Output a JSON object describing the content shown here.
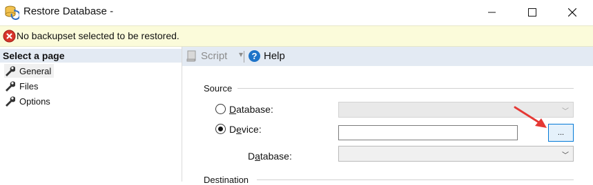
{
  "window": {
    "title": "Restore Database -",
    "controls": {
      "minimize": "—",
      "maximize": "☐",
      "close": "✕"
    }
  },
  "infobar": {
    "message": "No backupset selected to be restored.",
    "icon": "error-icon"
  },
  "sidebar": {
    "header": "Select a page",
    "items": [
      {
        "label": "General",
        "icon": "wrench-icon",
        "selected": true
      },
      {
        "label": "Files",
        "icon": "wrench-icon",
        "selected": false
      },
      {
        "label": "Options",
        "icon": "wrench-icon",
        "selected": false
      }
    ]
  },
  "toolbar": {
    "script_label": "Script",
    "dropdown_glyph": "▾",
    "help_label": "Help"
  },
  "source": {
    "group_label": "Source",
    "database_option": {
      "pre": "",
      "accel": "D",
      "post": "atabase:",
      "selected": false
    },
    "device_option": {
      "pre": "D",
      "accel": "e",
      "post": "vice:",
      "selected": true
    },
    "device_path": "",
    "browse_label": "...",
    "db_label": {
      "pre": "D",
      "accel": "a",
      "post": "tabase:"
    },
    "db_value": ""
  },
  "destination": {
    "group_label": "Destination"
  },
  "colors": {
    "infobar_bg": "#fbfbda",
    "header_bg": "#e3eaf3",
    "accent_blue": "#0078d7",
    "arrow_red": "#e53935"
  }
}
